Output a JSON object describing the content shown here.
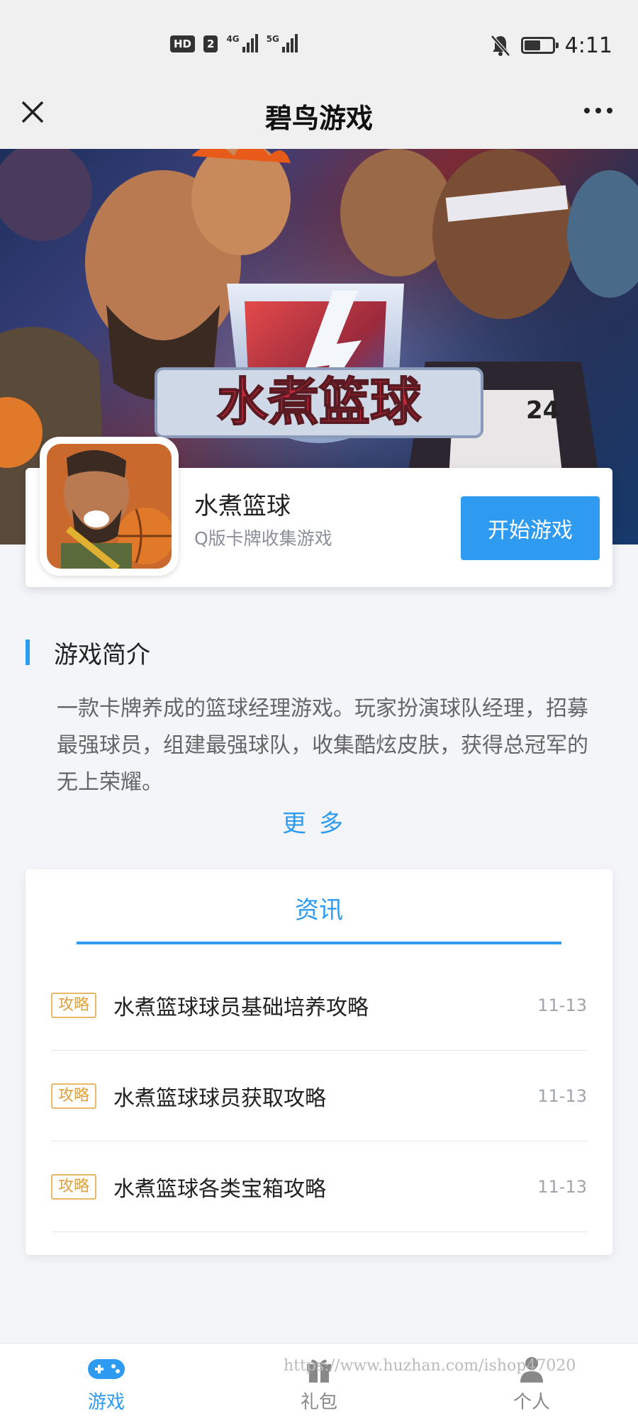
{
  "status_bar": {
    "hd_label": "HD",
    "sim_label": "2",
    "net1_label": "4G",
    "net2_label": "5G",
    "time": "4:11",
    "battery_level": 0.6
  },
  "nav": {
    "title": "碧鸟游戏"
  },
  "banner": {
    "logo_text": "水煮篮球",
    "jersey_number": "24"
  },
  "game": {
    "name": "水煮篮球",
    "subtitle": "Q版卡牌收集游戏",
    "start_label": "开始游戏"
  },
  "intro": {
    "title": "游戏简介",
    "text": "一款卡牌养成的篮球经理游戏。玩家扮演球队经理，招募最强球员，组建最强球队，收集酷炫皮肤，获得总冠军的无上荣耀。",
    "more_label": "更多"
  },
  "news": {
    "tab_label": "资讯",
    "items": [
      {
        "tag": "攻略",
        "title": "水煮篮球球员基础培养攻略",
        "date": "11-13"
      },
      {
        "tag": "攻略",
        "title": "水煮篮球球员获取攻略",
        "date": "11-13"
      },
      {
        "tag": "攻略",
        "title": "水煮篮球各类宝箱攻略",
        "date": "11-13"
      }
    ]
  },
  "tabs": [
    {
      "label": "游戏",
      "icon": "gamepad-icon",
      "active": true
    },
    {
      "label": "礼包",
      "icon": "gift-icon",
      "active": false
    },
    {
      "label": "个人",
      "icon": "person-icon",
      "active": false
    }
  ],
  "watermark": "https://www.huzhan.com/ishop47020",
  "colors": {
    "accent": "#2e9bf0",
    "tag": "#e0a23a"
  }
}
